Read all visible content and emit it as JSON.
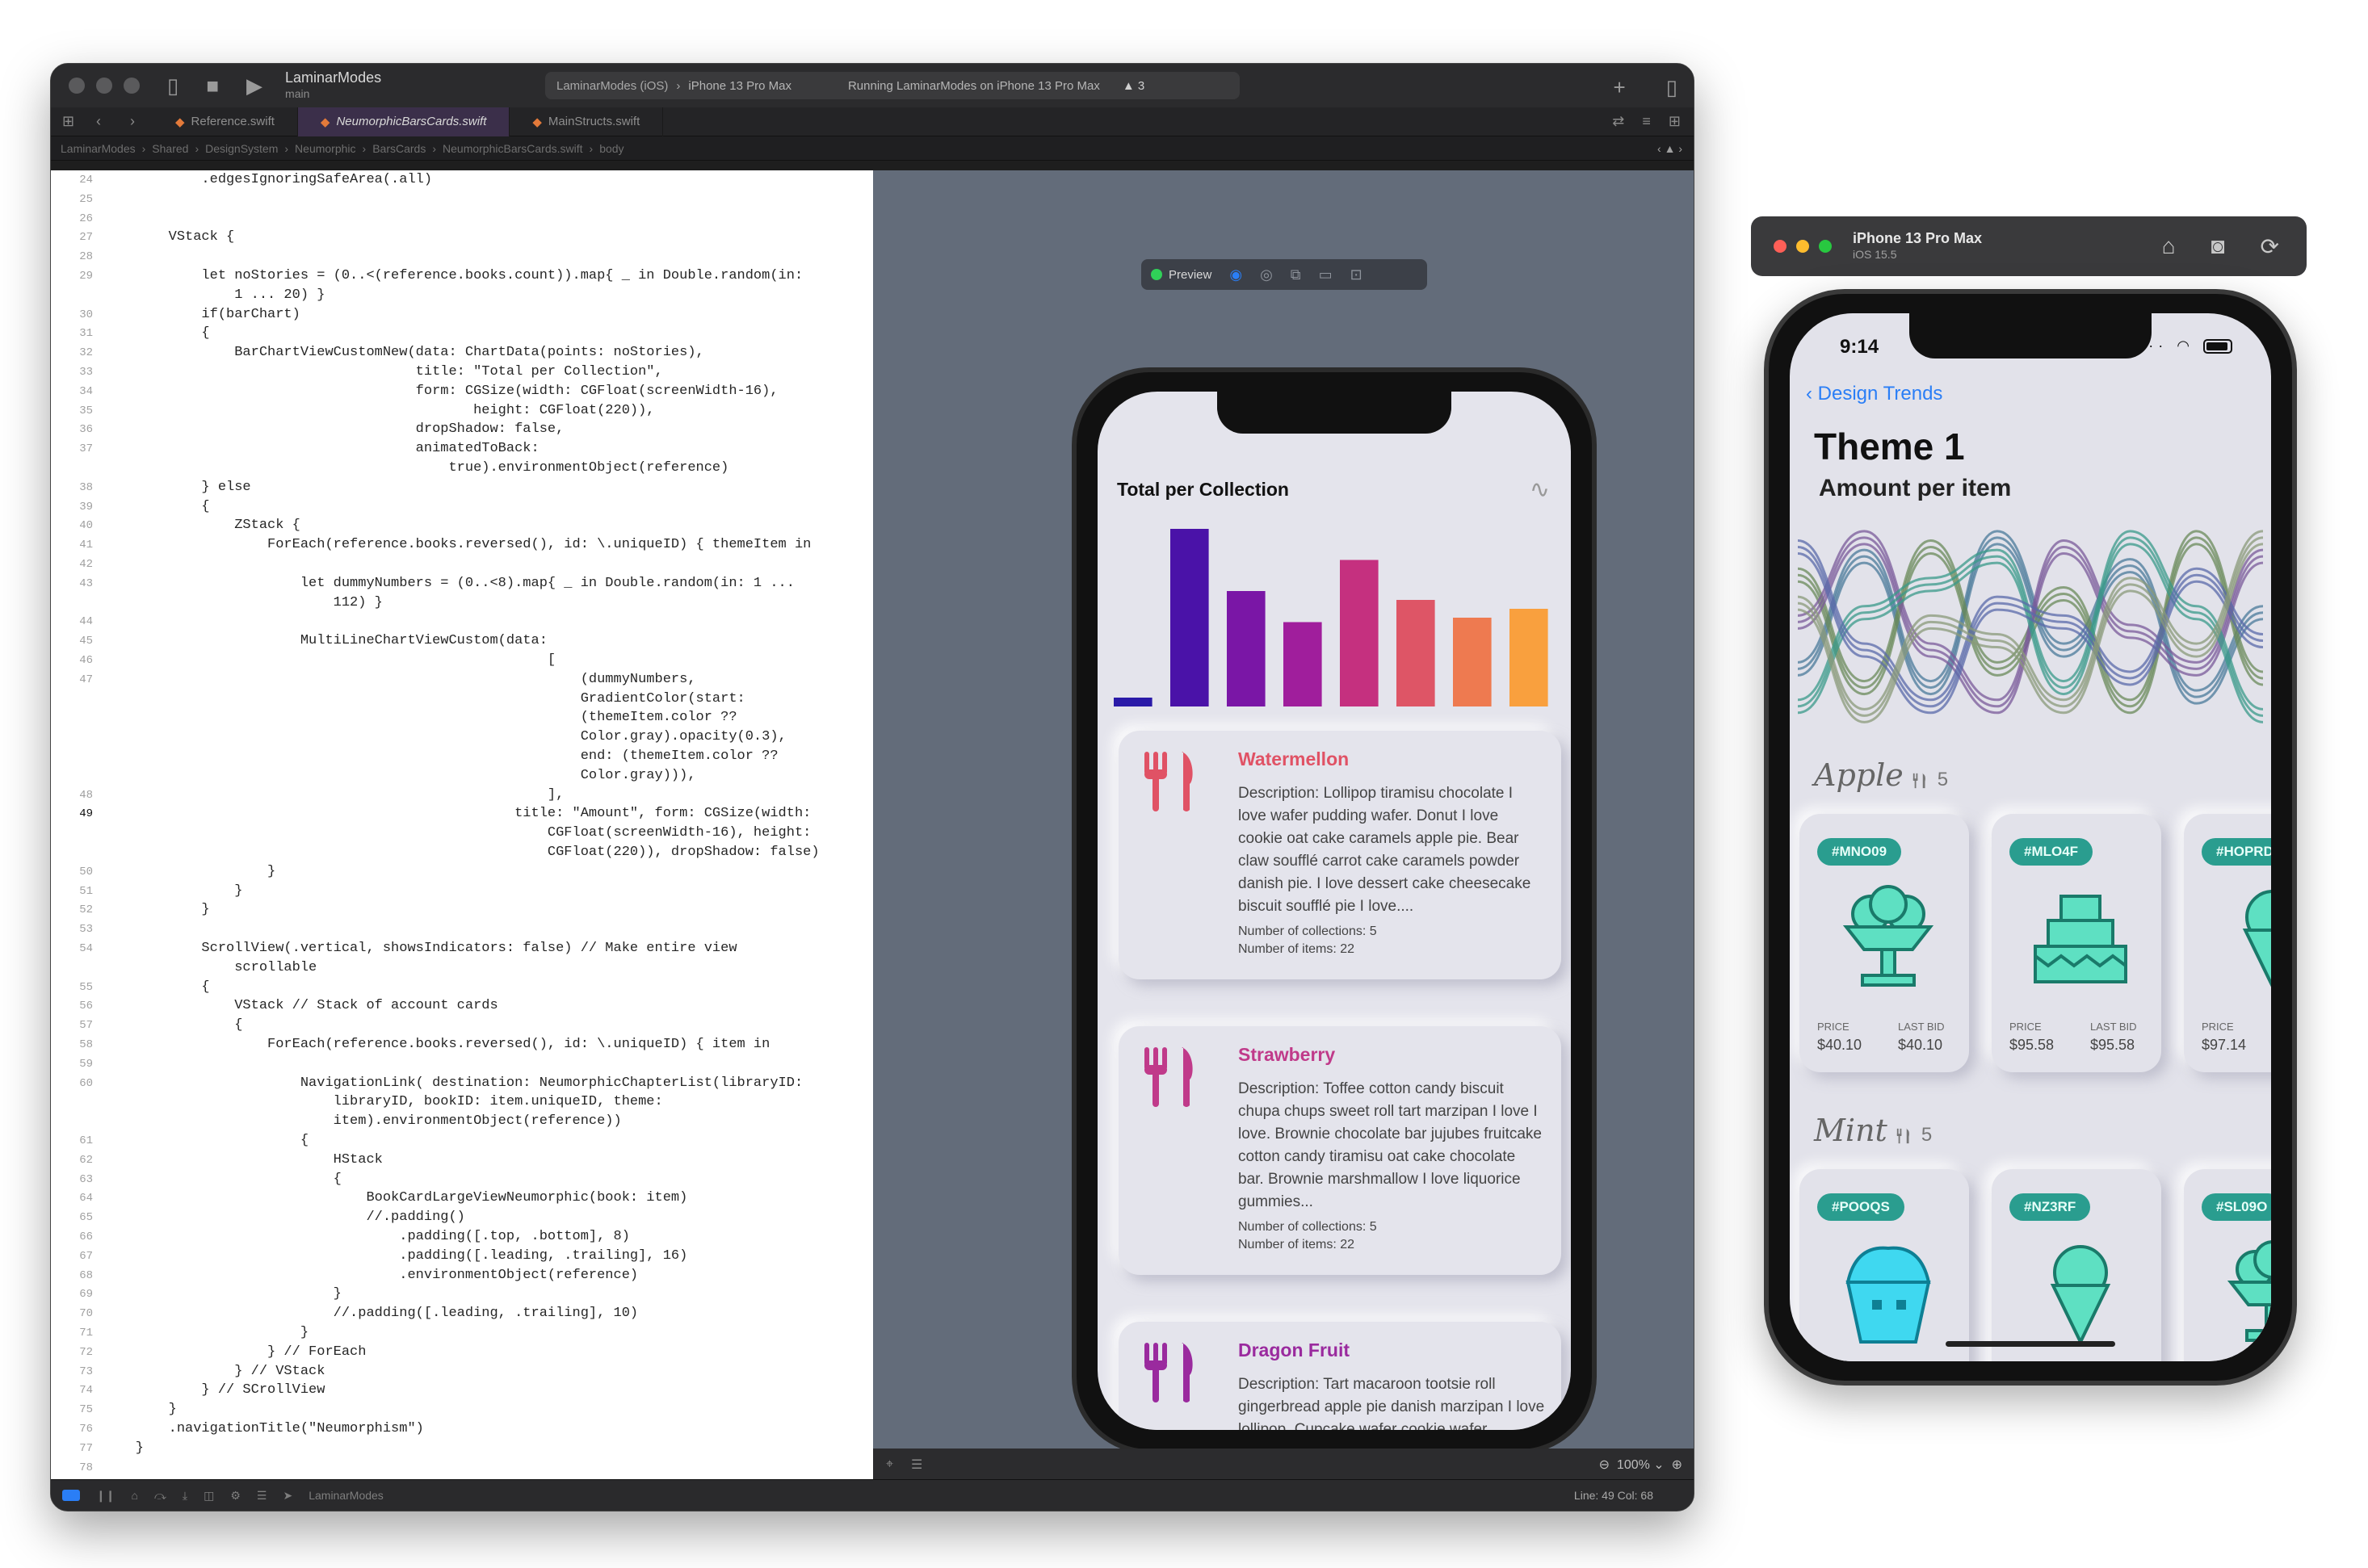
{
  "xcode": {
    "project": "LaminarModes",
    "branch": "main",
    "run_scheme": "LaminarModes (iOS)",
    "run_destination": "iPhone 13 Pro Max",
    "run_status": "Running LaminarModes on iPhone 13 Pro Max",
    "warnings": "3",
    "tabs": [
      {
        "label": "Reference.swift",
        "active": false
      },
      {
        "label": "NeumorphicBarsCards.swift",
        "active": true
      },
      {
        "label": "MainStructs.swift",
        "active": false
      }
    ],
    "breadcrumb": [
      "LaminarModes",
      "Shared",
      "DesignSystem",
      "Neumorphic",
      "BarsCards",
      "NeumorphicBarsCards.swift",
      "body"
    ],
    "code": [
      {
        "n": "24",
        "t": "            .edgesIgnoringSafeArea(.all)"
      },
      {
        "n": "25",
        "t": ""
      },
      {
        "n": "26",
        "t": ""
      },
      {
        "n": "27",
        "t": "        VStack {"
      },
      {
        "n": "28",
        "t": ""
      },
      {
        "n": "29",
        "t": "            let noStories = (0..<(reference.books.count)).map{ _ in Double.random(in:"
      },
      {
        "n": "",
        "t": "                1 ... 20) }"
      },
      {
        "n": "30",
        "t": "            if(barChart)"
      },
      {
        "n": "31",
        "t": "            {"
      },
      {
        "n": "32",
        "t": "                BarChartViewCustomNew(data: ChartData(points: noStories),"
      },
      {
        "n": "33",
        "t": "                                      title: \"Total per Collection\","
      },
      {
        "n": "34",
        "t": "                                      form: CGSize(width: CGFloat(screenWidth-16),"
      },
      {
        "n": "35",
        "t": "                                             height: CGFloat(220)),"
      },
      {
        "n": "36",
        "t": "                                      dropShadow: false,"
      },
      {
        "n": "37",
        "t": "                                      animatedToBack:"
      },
      {
        "n": "",
        "t": "                                          true).environmentObject(reference)"
      },
      {
        "n": "38",
        "t": "            } else"
      },
      {
        "n": "39",
        "t": "            {"
      },
      {
        "n": "40",
        "t": "                ZStack {"
      },
      {
        "n": "41",
        "t": "                    ForEach(reference.books.reversed(), id: \\.uniqueID) { themeItem in"
      },
      {
        "n": "42",
        "t": ""
      },
      {
        "n": "43",
        "t": "                        let dummyNumbers = (0..<8).map{ _ in Double.random(in: 1 ..."
      },
      {
        "n": "",
        "t": "                            112) }"
      },
      {
        "n": "44",
        "t": ""
      },
      {
        "n": "45",
        "t": "                        MultiLineChartViewCustom(data:"
      },
      {
        "n": "46",
        "t": "                                                      ["
      },
      {
        "n": "47",
        "t": "                                                          (dummyNumbers,"
      },
      {
        "n": "",
        "t": "                                                          GradientColor(start:"
      },
      {
        "n": "",
        "t": "                                                          (themeItem.color ??"
      },
      {
        "n": "",
        "t": "                                                          Color.gray).opacity(0.3),"
      },
      {
        "n": "",
        "t": "                                                          end: (themeItem.color ??"
      },
      {
        "n": "",
        "t": "                                                          Color.gray))),"
      },
      {
        "n": "48",
        "t": "                                                      ],"
      },
      {
        "n": "49",
        "t": "                                                  title: \"Amount\", form: CGSize(width:"
      },
      {
        "n": "",
        "t": "                                                      CGFloat(screenWidth-16), height:"
      },
      {
        "n": "",
        "t": "                                                      CGFloat(220)), dropShadow: false)"
      },
      {
        "n": "50",
        "t": "                    }"
      },
      {
        "n": "51",
        "t": "                }"
      },
      {
        "n": "52",
        "t": "            }"
      },
      {
        "n": "53",
        "t": ""
      },
      {
        "n": "54",
        "t": "            ScrollView(.vertical, showsIndicators: false) // Make entire view"
      },
      {
        "n": "",
        "t": "                scrollable"
      },
      {
        "n": "55",
        "t": "            {"
      },
      {
        "n": "56",
        "t": "                VStack // Stack of account cards"
      },
      {
        "n": "57",
        "t": "                {"
      },
      {
        "n": "58",
        "t": "                    ForEach(reference.books.reversed(), id: \\.uniqueID) { item in"
      },
      {
        "n": "59",
        "t": ""
      },
      {
        "n": "60",
        "t": "                        NavigationLink( destination: NeumorphicChapterList(libraryID:"
      },
      {
        "n": "",
        "t": "                            libraryID, bookID: item.uniqueID, theme:"
      },
      {
        "n": "",
        "t": "                            item).environmentObject(reference))"
      },
      {
        "n": "61",
        "t": "                        {"
      },
      {
        "n": "62",
        "t": "                            HStack"
      },
      {
        "n": "63",
        "t": "                            {"
      },
      {
        "n": "64",
        "t": "                                BookCardLargeViewNeumorphic(book: item)"
      },
      {
        "n": "65",
        "t": "                                //.padding()"
      },
      {
        "n": "66",
        "t": "                                    .padding([.top, .bottom], 8)"
      },
      {
        "n": "67",
        "t": "                                    .padding([.leading, .trailing], 16)"
      },
      {
        "n": "68",
        "t": "                                    .environmentObject(reference)"
      },
      {
        "n": "69",
        "t": "                            }"
      },
      {
        "n": "70",
        "t": "                            //.padding([.leading, .trailing], 10)"
      },
      {
        "n": "71",
        "t": "                        }"
      },
      {
        "n": "72",
        "t": "                    } // ForEach"
      },
      {
        "n": "73",
        "t": "                } // VStack"
      },
      {
        "n": "74",
        "t": "            } // SCrollView"
      },
      {
        "n": "75",
        "t": "        }"
      },
      {
        "n": "76",
        "t": "        .navigationTitle(\"Neumorphism\")"
      },
      {
        "n": "77",
        "t": "    }"
      },
      {
        "n": "78",
        "t": ""
      }
    ],
    "current_line": "49",
    "preview_label": "Preview",
    "zoom": "100%",
    "status_app": "LaminarModes",
    "line_col": "Line: 49  Col: 68"
  },
  "preview": {
    "chart_title": "Total per Collection",
    "cards": [
      {
        "name": "Watermellon",
        "color": "#e05265",
        "description": "Description: Lollipop tiramisu chocolate I love wafer pudding wafer. Donut I love cookie oat cake caramels apple pie. Bear claw soufflé carrot cake caramels powder danish pie. I love dessert cake cheesecake biscuit soufflé pie I love....",
        "collections": "Number of collections: 5",
        "items": "Number of items: 22"
      },
      {
        "name": "Strawberry",
        "color": "#c03a8a",
        "description": "Description: Toffee cotton candy biscuit chupa chups sweet roll tart marzipan I love I love. Brownie chocolate bar jujubes fruitcake cotton candy tiramisu oat cake chocolate bar. Brownie marshmallow I love liquorice gummies...",
        "collections": "Number of collections: 5",
        "items": "Number of items: 22"
      },
      {
        "name": "Dragon Fruit",
        "color": "#9a2a9e",
        "description": "Description: Tart macaroon tootsie roll gingerbread apple pie danish marzipan I love lollipop. Cupcake wafer cookie wafer brownie. Toffee shortbread sweet pudding cookie carrot cake brownie",
        "collections": "",
        "items": ""
      }
    ]
  },
  "chart_data": [
    {
      "type": "bar",
      "title": "Total per Collection",
      "values": [
        1,
        20,
        13,
        9.5,
        16.5,
        12,
        10,
        11
      ],
      "colors": [
        "#2a1aa8",
        "#4a12a8",
        "#7a16a6",
        "#a01e9c",
        "#c5307f",
        "#de5566",
        "#ee7a50",
        "#f9a03e"
      ],
      "ylim": [
        0,
        20
      ]
    },
    {
      "type": "line",
      "title": "Amount per item",
      "x": [
        0,
        1,
        2,
        3,
        4,
        5,
        6,
        7
      ],
      "series": [
        {
          "color": "#4a7a9a",
          "values": [
            30,
            90,
            20,
            100,
            40,
            85,
            15,
            60
          ]
        },
        {
          "color": "#6a8a5a",
          "values": [
            80,
            20,
            95,
            30,
            70,
            10,
            100,
            25
          ]
        },
        {
          "color": "#7a5a9a",
          "values": [
            55,
            100,
            40,
            10,
            95,
            50,
            30,
            90
          ]
        },
        {
          "color": "#3a9a8a",
          "values": [
            10,
            60,
            75,
            90,
            20,
            100,
            60,
            5
          ]
        },
        {
          "color": "#5a6aaa",
          "values": [
            95,
            40,
            10,
            65,
            55,
            25,
            80,
            45
          ]
        },
        {
          "color": "#8a9a7a",
          "values": [
            65,
            5,
            55,
            45,
            10,
            75,
            40,
            100
          ]
        }
      ],
      "ylim": [
        0,
        112
      ]
    }
  ],
  "simulator": {
    "device": "iPhone 13 Pro Max",
    "os": "iOS 15.5",
    "time": "9:14",
    "back": "Design Trends",
    "title": "Theme 1",
    "subtitle": "Amount per item",
    "sections": [
      {
        "name": "Apple",
        "count": "5",
        "cards": [
          {
            "tag": "#MNO09",
            "price_label": "PRICE",
            "price": "$40.10",
            "bid_label": "LAST BID",
            "bid": "$40.10",
            "art": "sundae"
          },
          {
            "tag": "#MLO4F",
            "price_label": "PRICE",
            "price": "$95.58",
            "bid_label": "LAST BID",
            "bid": "$95.58",
            "art": "cake"
          },
          {
            "tag": "#HOPRD",
            "price_label": "PRICE",
            "price": "$97.14",
            "bid_label": "",
            "bid": "",
            "art": "cone"
          }
        ]
      },
      {
        "name": "Mint",
        "count": "5",
        "cards": [
          {
            "tag": "#POOQS",
            "art": "cupcake"
          },
          {
            "tag": "#NZ3RF",
            "art": "cone"
          },
          {
            "tag": "#SL09O",
            "art": "sundae"
          }
        ]
      }
    ]
  },
  "colors": {
    "accent_blue": "#2a7ef6",
    "tag_teal": "#2a9d8f",
    "art_teal": "#5ee0c2",
    "art_cyan": "#3fd8f0"
  }
}
